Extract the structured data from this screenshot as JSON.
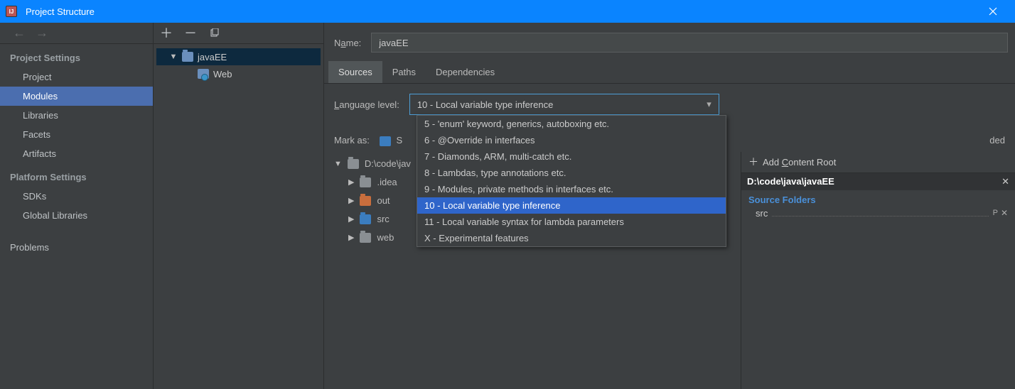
{
  "window": {
    "title": "Project Structure"
  },
  "settings_nav": {
    "sections": [
      {
        "title": "Project Settings",
        "items": [
          "Project",
          "Modules",
          "Libraries",
          "Facets",
          "Artifacts"
        ],
        "selected_index": 1
      },
      {
        "title": "Platform Settings",
        "items": [
          "SDKs",
          "Global Libraries"
        ]
      }
    ],
    "extra": "Problems"
  },
  "modules_tree": {
    "root": {
      "label": "javaEE"
    },
    "children": [
      {
        "label": "Web"
      }
    ]
  },
  "detail": {
    "name_label": "Name:",
    "name_value": "javaEE",
    "tabs": [
      "Sources",
      "Paths",
      "Dependencies"
    ],
    "active_tab_index": 0,
    "language_label": "Language level:",
    "language_selected": "10 - Local variable type inference",
    "language_options": [
      "5 - 'enum' keyword, generics, autoboxing etc.",
      "6 - @Override in interfaces",
      "7 - Diamonds, ARM, multi-catch etc.",
      "8 - Lambdas, type annotations etc.",
      "9 - Modules, private methods in interfaces etc.",
      "10 - Local variable type inference",
      "11 - Local variable syntax for lambda parameters",
      "X - Experimental features"
    ],
    "language_selected_option_index": 5,
    "mark_as_label": "Mark as:",
    "mark_as_truncated_option": "S",
    "mark_as_truncated_suffix": "ded",
    "content_root_path": "D:\\code\\jav",
    "content_root_path_full": "D:\\code\\java\\javaEE",
    "folders": [
      {
        "name": ".idea",
        "type": "gen"
      },
      {
        "name": "out",
        "type": "out"
      },
      {
        "name": "src",
        "type": "src"
      },
      {
        "name": "web",
        "type": "gen"
      }
    ]
  },
  "content_roots": {
    "add_label": "Add Content Root",
    "path": "D:\\code\\java\\javaEE",
    "source_folders_label": "Source Folders",
    "source_items": [
      "src"
    ]
  }
}
